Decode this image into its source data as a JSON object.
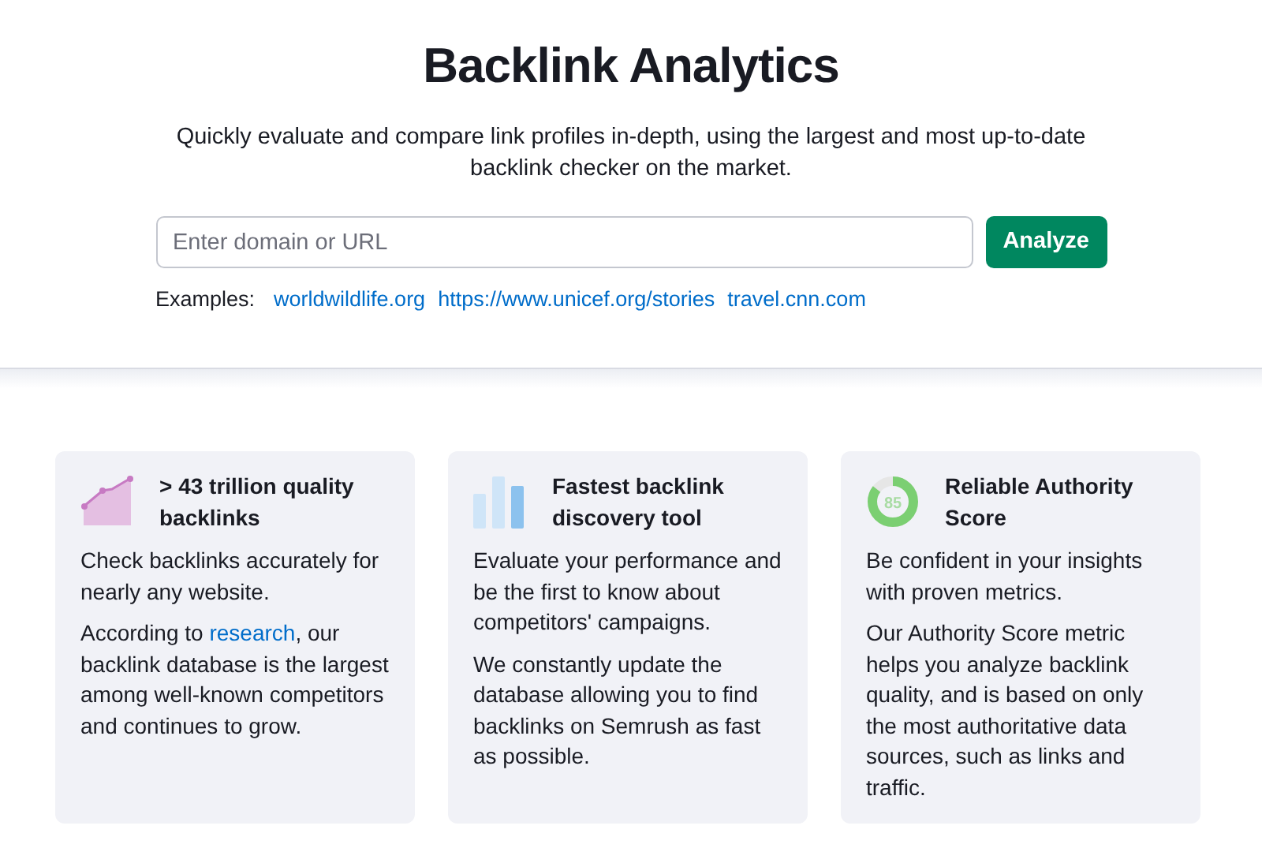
{
  "header": {
    "title": "Backlink Analytics",
    "subtitle": "Quickly evaluate and compare link profiles in-depth, using the largest and most up-to-date backlink checker on the market."
  },
  "search": {
    "placeholder": "Enter domain or URL",
    "button": "Analyze"
  },
  "examples": {
    "label": "Examples:",
    "links": [
      "worldwildlife.org",
      "https://www.unicef.org/stories",
      "travel.cnn.com"
    ]
  },
  "features": [
    {
      "kind": "area",
      "title": "> 43 trillion quality backlinks",
      "paragraphs": [
        [
          {
            "kind": "text",
            "text": "Check backlinks accurately for nearly any website."
          }
        ],
        [
          {
            "kind": "text",
            "text": "According to "
          },
          {
            "kind": "link",
            "text": "research"
          },
          {
            "kind": "text",
            "text": ", our backlink database is the largest among well-known competitors and continues to grow."
          }
        ]
      ]
    },
    {
      "kind": "bars",
      "title": "Fastest backlink discovery tool",
      "paragraphs": [
        [
          {
            "kind": "text",
            "text": "Evaluate your performance and be the first to know about competitors' campaigns."
          }
        ],
        [
          {
            "kind": "text",
            "text": "We constantly update the database allowing you to find backlinks on Semrush as fast as possible."
          }
        ]
      ]
    },
    {
      "kind": "score",
      "score": "85",
      "level": 0.85,
      "title": "Reliable Authority Score",
      "paragraphs": [
        [
          {
            "kind": "text",
            "text": "Be confident in your insights with proven metrics."
          }
        ],
        [
          {
            "kind": "text",
            "text": "Our Authority Score metric helps you analyze backlink quality, and is based on only the most authoritative data sources, such as links and traffic."
          }
        ]
      ]
    }
  ]
}
